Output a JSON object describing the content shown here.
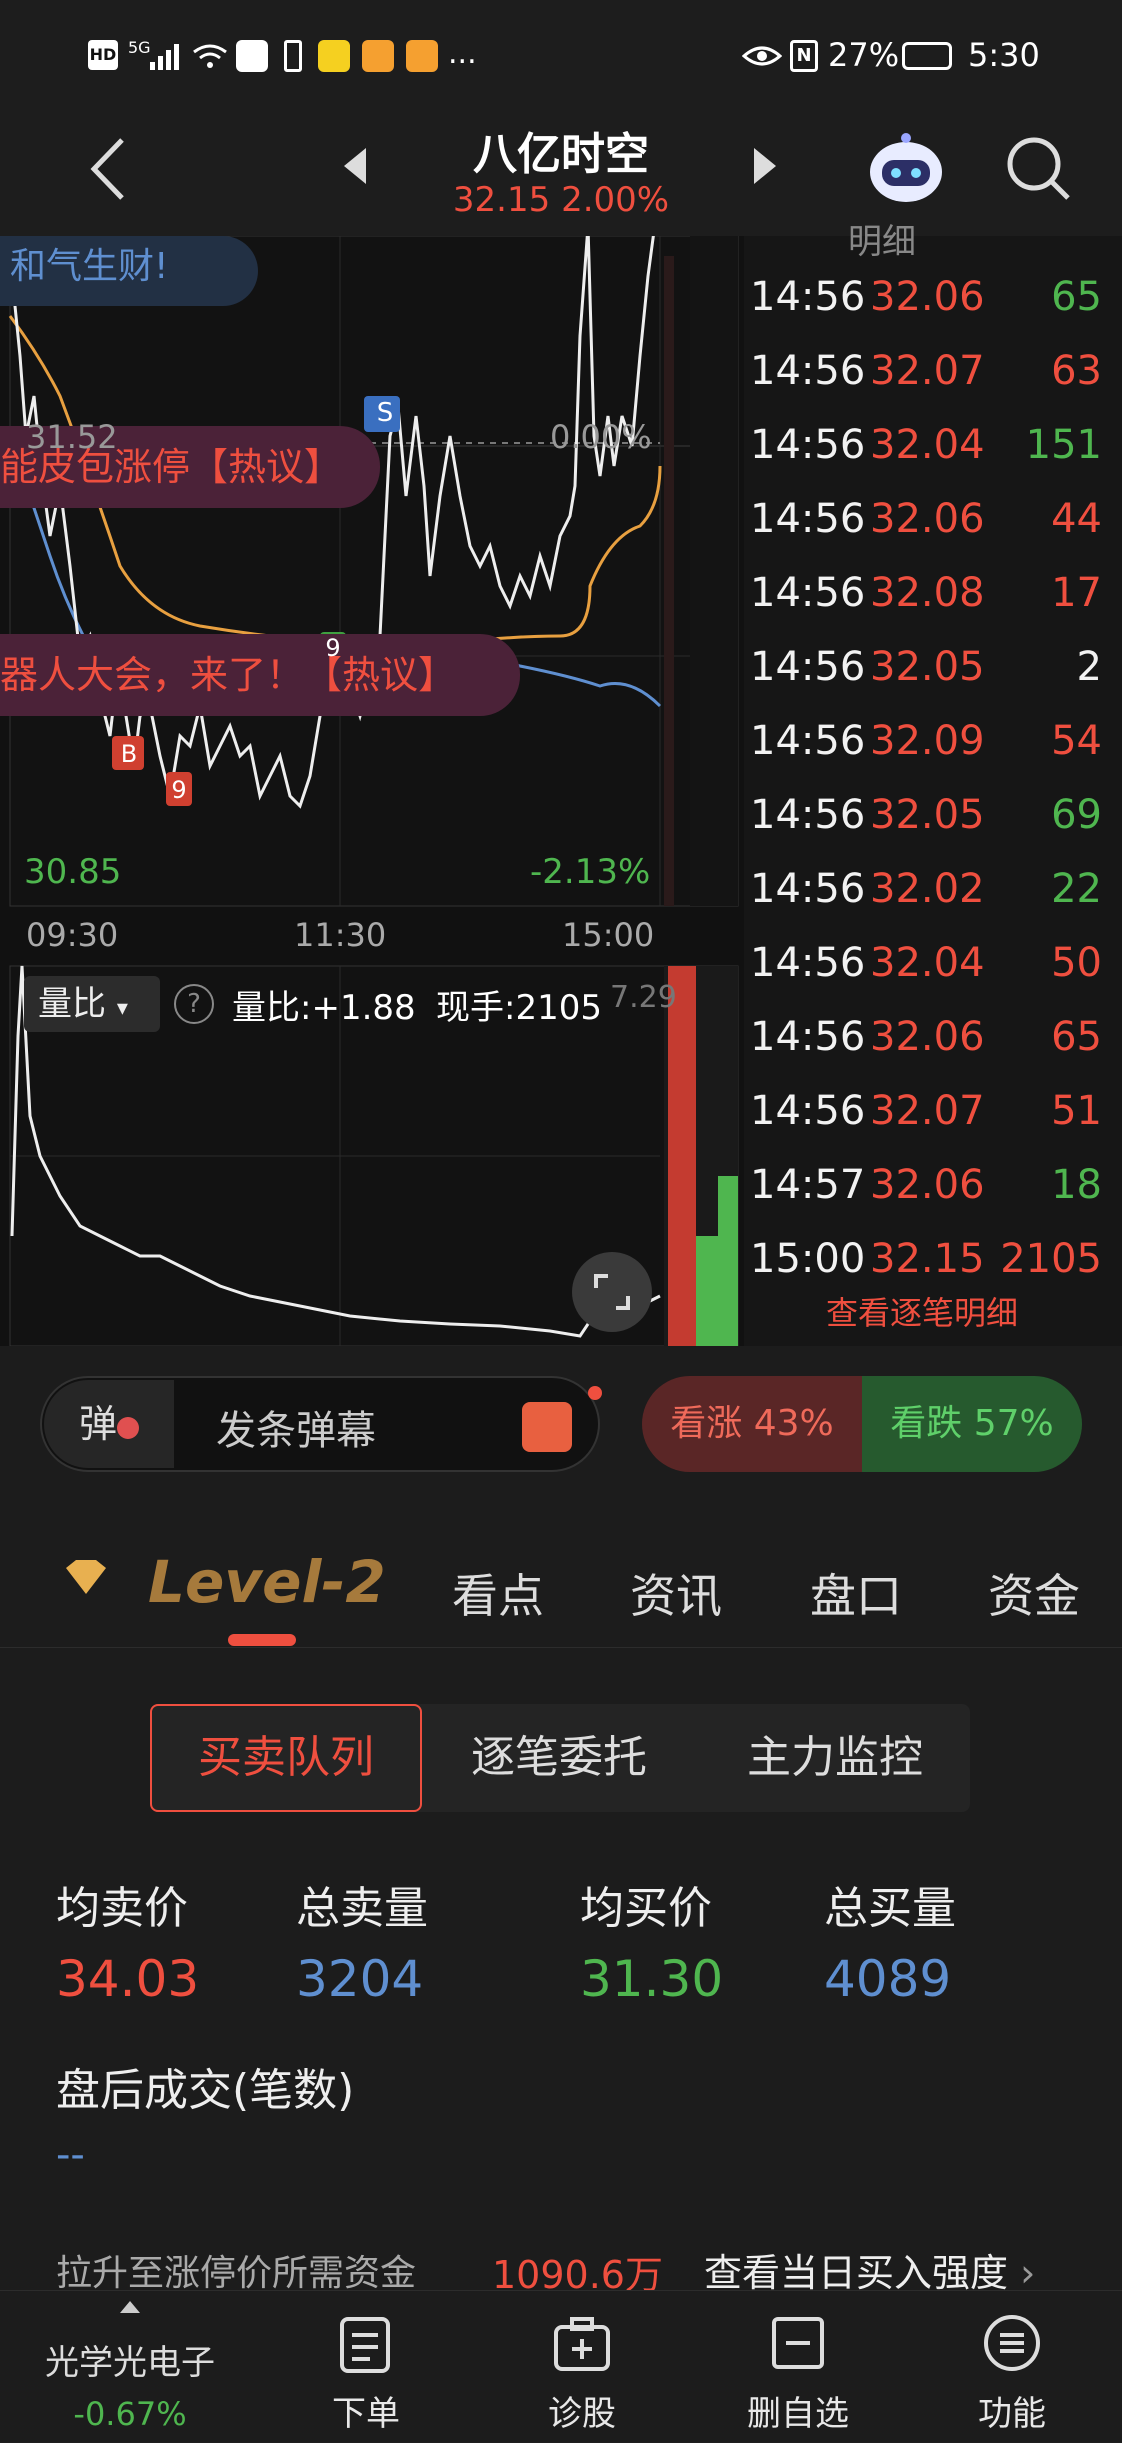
{
  "status_bar": {
    "left_icons": [
      "HD",
      "5G",
      "wifi-icon",
      "notification-icon",
      "sim-icon",
      "app-icon",
      "app-icon",
      "app-icon",
      "..."
    ],
    "battery": "27%",
    "time": "5:30"
  },
  "header": {
    "title": "八亿时空",
    "price": "32.15",
    "change": "2.00%"
  },
  "chart": {
    "banner_top": "和气生财!",
    "banner_mid": "能皮包涨停【热议】",
    "banner_bot": "器人大会，来了！【热议】",
    "price_ref": "31.52",
    "pct_ref": "0.00%",
    "low_price": "30.85",
    "low_pct": "-2.13%",
    "marker_s": "S",
    "marker_b": "B",
    "marker_9a": "9",
    "marker_9b": "9",
    "times": [
      "09:30",
      "11:30",
      "15:00"
    ],
    "indicator_label": "量比",
    "indicator_value": "量比:+1.88",
    "current_hand": "现手:2105",
    "indicator_right": "7.29"
  },
  "trades": {
    "header": "明细",
    "rows": [
      {
        "time": "14:56",
        "price": "32.06",
        "vol": "65",
        "color": "green"
      },
      {
        "time": "14:56",
        "price": "32.07",
        "vol": "63",
        "color": "red"
      },
      {
        "time": "14:56",
        "price": "32.04",
        "vol": "151",
        "color": "green"
      },
      {
        "time": "14:56",
        "price": "32.06",
        "vol": "44",
        "color": "red"
      },
      {
        "time": "14:56",
        "price": "32.08",
        "vol": "17",
        "color": "red"
      },
      {
        "time": "14:56",
        "price": "32.05",
        "vol": "2",
        "color": "white"
      },
      {
        "time": "14:56",
        "price": "32.09",
        "vol": "54",
        "color": "red"
      },
      {
        "time": "14:56",
        "price": "32.05",
        "vol": "69",
        "color": "green"
      },
      {
        "time": "14:56",
        "price": "32.02",
        "vol": "22",
        "color": "green"
      },
      {
        "time": "14:56",
        "price": "32.04",
        "vol": "50",
        "color": "red"
      },
      {
        "time": "14:56",
        "price": "32.06",
        "vol": "65",
        "color": "red"
      },
      {
        "time": "14:56",
        "price": "32.07",
        "vol": "51",
        "color": "red"
      },
      {
        "time": "14:57",
        "price": "32.06",
        "vol": "18",
        "color": "green"
      },
      {
        "time": "15:00",
        "price": "32.15",
        "vol": "2105",
        "color": "red"
      }
    ],
    "view_all": "查看逐笔明细"
  },
  "danmu": {
    "icon_label": "弹",
    "placeholder": "发条弹幕",
    "bull": "看涨 43%",
    "bear": "看跌 57%"
  },
  "tabs": [
    "Level-2",
    "看点",
    "资讯",
    "盘口",
    "资金"
  ],
  "subtabs": [
    "买卖队列",
    "逐笔委托",
    "主力监控"
  ],
  "stats": {
    "labels": [
      "均卖价",
      "总卖量",
      "均买价",
      "总买量"
    ],
    "values": [
      "34.03",
      "3204",
      "31.30",
      "4089"
    ]
  },
  "after_hours": {
    "label": "盘后成交(笔数)",
    "value": "--"
  },
  "limit_up": {
    "label": "拉升至涨停价所需资金",
    "value": "1090.6万",
    "link": "查看当日买入强度"
  },
  "bottom_nav": {
    "stock_name": "光学光电子",
    "stock_change": "-0.67%",
    "items": [
      "下单",
      "诊股",
      "删自选",
      "功能"
    ]
  },
  "colors": {
    "red": "#ef4f3f",
    "green": "#4fb64f",
    "blue": "#5f8fd0",
    "orange": "#e8a040"
  }
}
